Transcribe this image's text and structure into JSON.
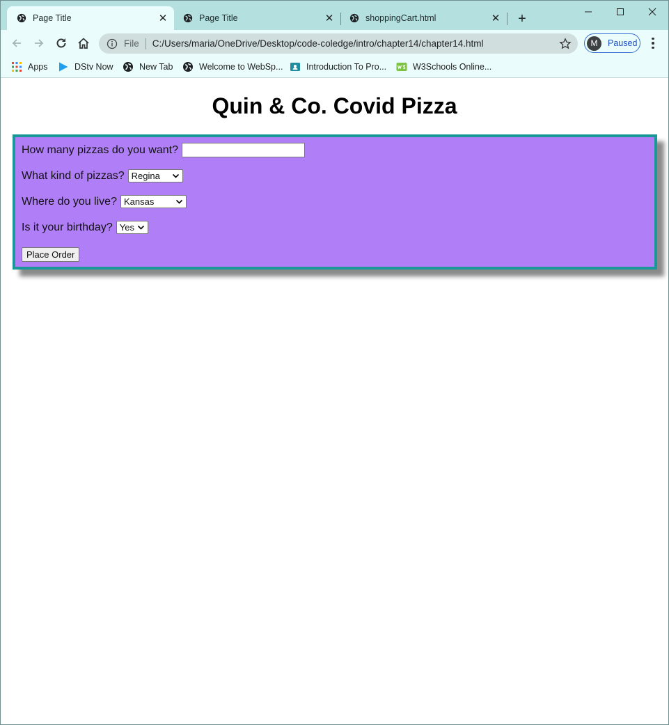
{
  "browser": {
    "tabs": [
      {
        "title": "Page Title",
        "active": true
      },
      {
        "title": "Page Title",
        "active": false
      },
      {
        "title": "shoppingCart.html",
        "active": false
      }
    ],
    "address": {
      "scheme_label": "File",
      "url": "C:/Users/maria/OneDrive/Desktop/code-coledge/intro/chapter14/chapter14.html"
    },
    "profile": {
      "initial": "M",
      "status": "Paused"
    },
    "bookmarks": [
      {
        "label": "Apps",
        "icon": "apps-grid-icon"
      },
      {
        "label": "DStv Now",
        "icon": "dstv-play-icon"
      },
      {
        "label": "New Tab",
        "icon": "globe-icon"
      },
      {
        "label": "Welcome to WebSp...",
        "icon": "globe-icon"
      },
      {
        "label": "Introduction To Pro...",
        "icon": "classroom-icon"
      },
      {
        "label": "W3Schools Online...",
        "icon": "w3schools-icon"
      }
    ]
  },
  "page": {
    "heading": "Quin & Co. Covid Pizza",
    "form": {
      "quantity_label": "How many pizzas do you want?",
      "quantity_value": "",
      "kind_label": "What kind of pizzas?",
      "kind_selected": "Regina",
      "location_label": "Where do you live?",
      "location_selected": "Kansas",
      "birthday_label": "Is it your birthday?",
      "birthday_selected": "Yes",
      "submit_label": "Place Order"
    }
  },
  "colors": {
    "tabstrip": "#b4e0e0",
    "toolbar": "#eafcfc",
    "form_background": "#b07ff7",
    "form_border": "#1a9898"
  }
}
